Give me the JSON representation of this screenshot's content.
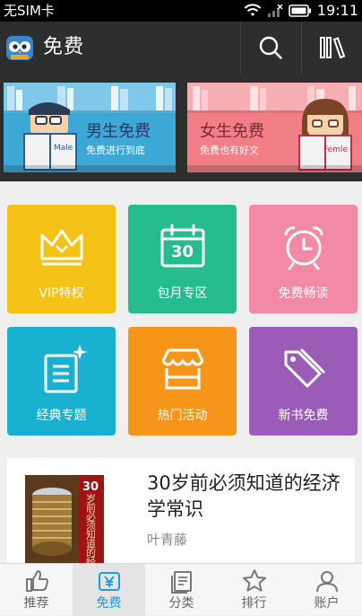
{
  "status_bar": {
    "carrier": "无SIM卡",
    "time": "19:11"
  },
  "app_bar": {
    "title": "免费",
    "icons": [
      "owl-logo-icon",
      "search-icon",
      "bookshelf-icon"
    ]
  },
  "banners": [
    {
      "title": "男生免费",
      "subtitle": "免费进行到底",
      "book_text": "Male",
      "bg": "#3da7d6"
    },
    {
      "title": "女生免费",
      "subtitle": "免费也有好文",
      "book_text": "Femle",
      "bg": "#f27f85"
    }
  ],
  "tiles": [
    {
      "label": "VIP特权",
      "icon": "crown-icon",
      "color": "#f5c217"
    },
    {
      "label": "包月专区",
      "icon": "calendar-30-icon",
      "color": "#27bc8f",
      "icon_text": "30"
    },
    {
      "label": "免费畅读",
      "icon": "alarm-clock-icon",
      "color": "#f28aa4"
    },
    {
      "label": "经典专题",
      "icon": "document-sparkle-icon",
      "color": "#1ab0cf"
    },
    {
      "label": "热门活动",
      "icon": "storefront-icon",
      "color": "#f5961b"
    },
    {
      "label": "新书免费",
      "icon": "price-tag-icon",
      "color": "#9b5cb8"
    }
  ],
  "book": {
    "title": "30岁前必须知道的经济学常识",
    "author": "叶青藤",
    "cover_number": "30",
    "cover_vertical_text": "岁前必须知道的经"
  },
  "tab_bar": {
    "active": "免费",
    "items": [
      {
        "label": "推荐",
        "icon": "thumbs-up-icon"
      },
      {
        "label": "免费",
        "icon": "yen-wallet-icon"
      },
      {
        "label": "分类",
        "icon": "book-category-icon"
      },
      {
        "label": "排行",
        "icon": "star-icon"
      },
      {
        "label": "账户",
        "icon": "user-icon"
      }
    ]
  },
  "colors": {
    "accent": "#1a9be0",
    "app_bar_bg": "#2e2e2e"
  }
}
